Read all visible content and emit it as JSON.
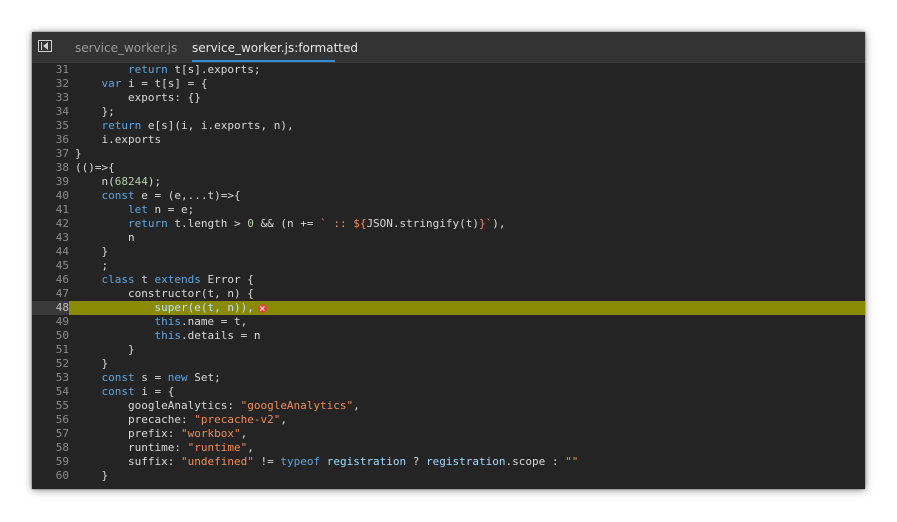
{
  "tabs": [
    {
      "label": "service_worker.js",
      "active": false
    },
    {
      "label": "service_worker.js:formatted",
      "active": true,
      "close_glyph": "×"
    }
  ],
  "code": {
    "highlighted_line": "48",
    "lines": [
      {
        "num": "31",
        "indent": "        ",
        "tokens": [
          {
            "t": "return",
            "c": "kw"
          },
          {
            "t": " t[s].exports;"
          }
        ]
      },
      {
        "num": "32",
        "indent": "    ",
        "tokens": [
          {
            "t": "var",
            "c": "kw"
          },
          {
            "t": " i = t[s] = {"
          }
        ]
      },
      {
        "num": "33",
        "indent": "        ",
        "tokens": [
          {
            "t": "exports: {}"
          }
        ]
      },
      {
        "num": "34",
        "indent": "    ",
        "tokens": [
          {
            "t": "};"
          }
        ]
      },
      {
        "num": "35",
        "indent": "    ",
        "tokens": [
          {
            "t": "return",
            "c": "kw"
          },
          {
            "t": " e[s](i, i.exports, n),"
          }
        ]
      },
      {
        "num": "36",
        "indent": "    ",
        "tokens": [
          {
            "t": "i.exports"
          }
        ]
      },
      {
        "num": "37",
        "indent": "",
        "tokens": [
          {
            "t": "}"
          }
        ]
      },
      {
        "num": "38",
        "indent": "",
        "tokens": [
          {
            "t": "(()=>{"
          }
        ]
      },
      {
        "num": "39",
        "indent": "    ",
        "tokens": [
          {
            "t": "n("
          },
          {
            "t": "68244",
            "c": "num"
          },
          {
            "t": ");"
          }
        ]
      },
      {
        "num": "40",
        "indent": "    ",
        "tokens": [
          {
            "t": "const",
            "c": "kw"
          },
          {
            "t": " e = (e,...t)=>{"
          }
        ]
      },
      {
        "num": "41",
        "indent": "        ",
        "tokens": [
          {
            "t": "let",
            "c": "kw"
          },
          {
            "t": " n = e;"
          }
        ]
      },
      {
        "num": "42",
        "indent": "        ",
        "tokens": [
          {
            "t": "return",
            "c": "kw"
          },
          {
            "t": " t.length > "
          },
          {
            "t": "0",
            "c": "num"
          },
          {
            "t": " && (n += "
          },
          {
            "t": "` :: ${",
            "c": "str"
          },
          {
            "t": "JSON.stringify(t)"
          },
          {
            "t": "}`",
            "c": "str"
          },
          {
            "t": "),"
          }
        ]
      },
      {
        "num": "43",
        "indent": "        ",
        "tokens": [
          {
            "t": "n"
          }
        ]
      },
      {
        "num": "44",
        "indent": "    ",
        "tokens": [
          {
            "t": "}"
          }
        ]
      },
      {
        "num": "45",
        "indent": "    ",
        "tokens": [
          {
            "t": ";"
          }
        ]
      },
      {
        "num": "46",
        "indent": "    ",
        "tokens": [
          {
            "t": "class",
            "c": "kw"
          },
          {
            "t": " t "
          },
          {
            "t": "extends",
            "c": "kw"
          },
          {
            "t": " Error {"
          }
        ]
      },
      {
        "num": "47",
        "indent": "        ",
        "tokens": [
          {
            "t": "constructor(t, n) {"
          }
        ]
      },
      {
        "num": "48",
        "indent": "            ",
        "tokens": [
          {
            "t": "super",
            "c": "hl-kw"
          },
          {
            "t": "(e(t, n)),",
            "c": "hl-kw"
          }
        ],
        "error": true
      },
      {
        "num": "49",
        "indent": "            ",
        "tokens": [
          {
            "t": "this",
            "c": "kw"
          },
          {
            "t": ".name = t,"
          }
        ]
      },
      {
        "num": "50",
        "indent": "            ",
        "tokens": [
          {
            "t": "this",
            "c": "kw"
          },
          {
            "t": ".details = n"
          }
        ]
      },
      {
        "num": "51",
        "indent": "        ",
        "tokens": [
          {
            "t": "}"
          }
        ]
      },
      {
        "num": "52",
        "indent": "    ",
        "tokens": [
          {
            "t": "}"
          }
        ]
      },
      {
        "num": "53",
        "indent": "    ",
        "tokens": [
          {
            "t": "const",
            "c": "kw"
          },
          {
            "t": " s = "
          },
          {
            "t": "new",
            "c": "kw"
          },
          {
            "t": " Set;"
          }
        ]
      },
      {
        "num": "54",
        "indent": "    ",
        "tokens": [
          {
            "t": "const",
            "c": "kw"
          },
          {
            "t": " i = {"
          }
        ]
      },
      {
        "num": "55",
        "indent": "        ",
        "tokens": [
          {
            "t": "googleAnalytics: "
          },
          {
            "t": "\"googleAnalytics\"",
            "c": "str"
          },
          {
            "t": ","
          }
        ]
      },
      {
        "num": "56",
        "indent": "        ",
        "tokens": [
          {
            "t": "precache: "
          },
          {
            "t": "\"precache-v2\"",
            "c": "str"
          },
          {
            "t": ","
          }
        ]
      },
      {
        "num": "57",
        "indent": "        ",
        "tokens": [
          {
            "t": "prefix: "
          },
          {
            "t": "\"workbox\"",
            "c": "str"
          },
          {
            "t": ","
          }
        ]
      },
      {
        "num": "58",
        "indent": "        ",
        "tokens": [
          {
            "t": "runtime: "
          },
          {
            "t": "\"runtime\"",
            "c": "str"
          },
          {
            "t": ","
          }
        ]
      },
      {
        "num": "59",
        "indent": "        ",
        "tokens": [
          {
            "t": "suffix: "
          },
          {
            "t": "\"undefined\"",
            "c": "str"
          },
          {
            "t": " != "
          },
          {
            "t": "typeof",
            "c": "kw"
          },
          {
            "t": " "
          },
          {
            "t": "registration",
            "c": "ident"
          },
          {
            "t": " ? "
          },
          {
            "t": "registration",
            "c": "ident"
          },
          {
            "t": ".scope : "
          },
          {
            "t": "\"\"",
            "c": "str"
          }
        ]
      },
      {
        "num": "60",
        "indent": "    ",
        "tokens": [
          {
            "t": "}"
          }
        ]
      }
    ]
  },
  "colors": {
    "background": "#242424",
    "tabbar": "#333333",
    "active_tab_underline": "#2f8dd7",
    "highlight_line": "#8a8a05",
    "keyword": "#5ea5e0",
    "string": "#f28b54",
    "error_icon": "#e0443d"
  }
}
